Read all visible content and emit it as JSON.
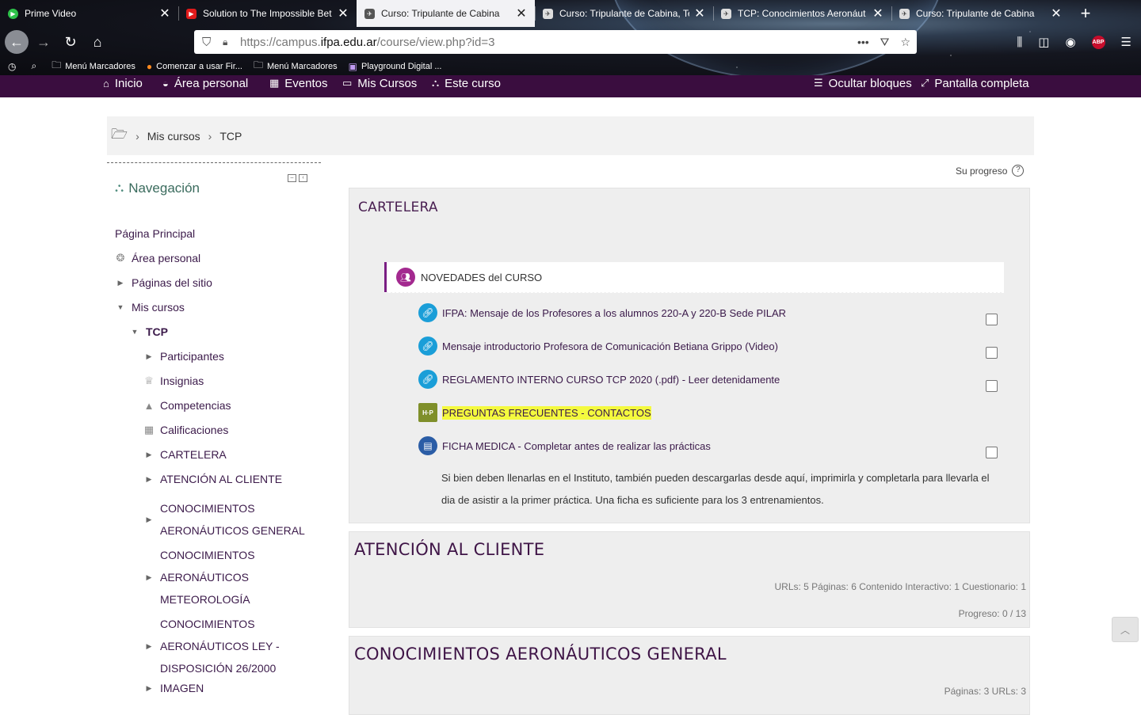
{
  "browser": {
    "tabs": [
      {
        "title": "Prime Video",
        "active": false,
        "favicon_color": "#2ec24a"
      },
      {
        "title": "Solution to The Impossible Bet",
        "active": false,
        "favicon_color": "#e01b1b"
      },
      {
        "title": "Curso: Tripulante de Cabina",
        "active": true,
        "favicon_color": "#ffffff"
      },
      {
        "title": "Curso: Tripulante de Cabina, Te",
        "active": false,
        "favicon_color": "#ffffff"
      },
      {
        "title": "TCP: Conocimientos Aeronáut",
        "active": false,
        "favicon_color": "#ffffff"
      },
      {
        "title": "Curso: Tripulante de Cabina",
        "active": false,
        "favicon_color": "#ffffff"
      }
    ],
    "url_prefix": "https://campus.",
    "url_domain": "ifpa.edu.ar",
    "url_path": "/course/view.php?id=3",
    "bookmarks": [
      {
        "label": "Menú Marcadores",
        "icon": "folder-icon"
      },
      {
        "label": "Comenzar a usar Fir...",
        "icon": "firefox-icon"
      },
      {
        "label": "Menú Marcadores",
        "icon": "folder-icon"
      },
      {
        "label": "Playground Digital ...",
        "icon": "playground-icon"
      }
    ],
    "abp_label": "ABP"
  },
  "moodle_nav": {
    "inicio": "Inicio",
    "area_personal": "Área personal",
    "eventos": "Eventos",
    "mis_cursos": "Mis Cursos",
    "este_curso": "Este curso",
    "ocultar_bloques": "Ocultar bloques",
    "pantalla_completa": "Pantalla completa"
  },
  "breadcrumb": {
    "mis_cursos": "Mis cursos",
    "tcp": "TCP"
  },
  "navigation_block": {
    "title": "Navegación",
    "items": {
      "pagina_principal": "Página Principal",
      "area_personal": "Área personal",
      "paginas_sitio": "Páginas del sitio",
      "mis_cursos": "Mis cursos",
      "tcp": "TCP",
      "participantes": "Participantes",
      "insignias": "Insignias",
      "competencias": "Competencias",
      "calificaciones": "Calificaciones",
      "cartelera": "CARTELERA",
      "atencion": "ATENCIÓN AL CLIENTE",
      "conoc_general_1": "CONOCIMIENTOS",
      "conoc_general_2": "AERONÁUTICOS GENERAL",
      "conoc_meteo_1": "CONOCIMIENTOS",
      "conoc_meteo_2": "AERONÁUTICOS",
      "conoc_meteo_3": "METEOROLOGÍA",
      "conoc_ley_1": "CONOCIMIENTOS",
      "conoc_ley_2": "AERONÁUTICOS LEY -",
      "conoc_ley_3": "DISPOSICIÓN 26/2000",
      "imagen": "IMAGEN"
    }
  },
  "main": {
    "progress_label": "Su progreso",
    "cartelera": {
      "title": "CARTELERA",
      "forum": "NOVEDADES del CURSO",
      "activities": [
        {
          "label": "IFPA: Mensaje de los Profesores a los alumnos 220-A y 220-B Sede PILAR",
          "type": "url"
        },
        {
          "label": "Mensaje introductorio Profesora de Comunicación Betiana Grippo (Video)",
          "type": "url"
        },
        {
          "label": "REGLAMENTO INTERNO CURSO TCP 2020 (.pdf) - Leer detenidamente",
          "type": "url"
        },
        {
          "label": "PREGUNTAS FRECUENTES - CONTACTOS",
          "type": "h5p"
        },
        {
          "label": "FICHA MEDICA - Completar antes de realizar las prácticas",
          "type": "page"
        }
      ],
      "description": "Si bien deben llenarlas en el Instituto, también pueden descargarlas desde aquí, imprimirla y completarla para llevarla el dia de asistir a la primer práctica.  Una ficha es suficiente para los 3 entrenamientos."
    },
    "atencion": {
      "title": "ATENCIÓN AL CLIENTE",
      "summary": "URLs: 5  Páginas: 6  Contenido Interactivo: 1  Cuestionario: 1",
      "progress": "Progreso: 0 / 13"
    },
    "conoc_general": {
      "title": "CONOCIMIENTOS AERONÁUTICOS GENERAL",
      "summary": "Páginas: 3  URLs: 3"
    }
  }
}
